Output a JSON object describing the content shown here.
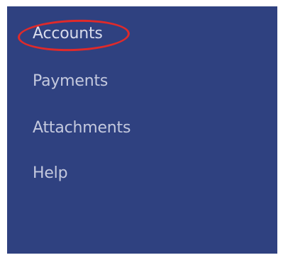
{
  "nav": {
    "items": [
      {
        "label": "Accounts",
        "active": true
      },
      {
        "label": "Payments",
        "active": false
      },
      {
        "label": "Attachments",
        "active": false
      },
      {
        "label": "Help",
        "active": false
      }
    ],
    "highlight_color": "#e02a2a",
    "background_color": "#2f4180",
    "text_color": "#c4c9de"
  }
}
